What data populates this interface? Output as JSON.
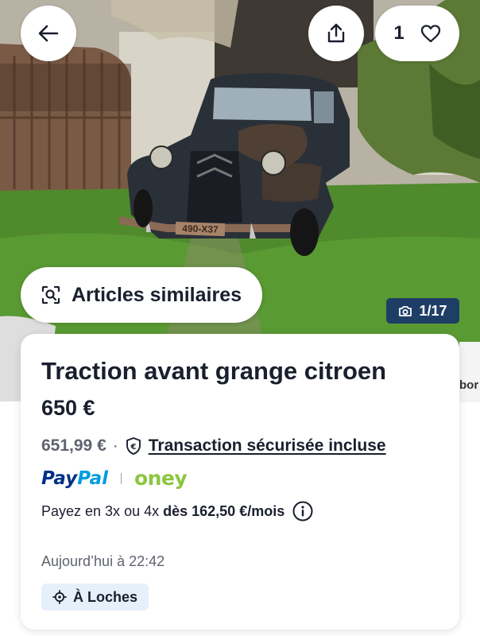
{
  "photo": {
    "plate_text": "490-X37"
  },
  "header": {
    "favorites_count": "1"
  },
  "similar": {
    "label": "Articles similaires"
  },
  "photo_counter": {
    "text": "1/17"
  },
  "listing": {
    "title": "Traction avant grange citroen",
    "price": "650 €",
    "total_price": "651,99 €",
    "separator": "·",
    "secure_label": "Transaction sécurisée incluse",
    "paypal_pay": "Pay",
    "paypal_pal": "Pal",
    "oney": "oney",
    "installments_prefix": "Payez en 3x ou 4x",
    "installments_amount": "dès 162,50 €/mois",
    "date": "Aujourd’hui à 22:42",
    "location": "À Loches"
  },
  "next_card": {
    "peek_text": "bor"
  },
  "icons": {
    "back": "arrow-left-icon",
    "share": "share-icon",
    "favorite": "heart-icon",
    "similar": "image-search-icon",
    "camera": "camera-icon",
    "shield": "shield-euro-icon",
    "info": "info-icon",
    "location": "location-target-icon"
  },
  "colors": {
    "counter_bg": "#1f3e66",
    "location_bg": "#e6f0fb",
    "paypal_dark": "#003087",
    "paypal_light": "#009cde",
    "oney_green": "#8cc63f"
  }
}
